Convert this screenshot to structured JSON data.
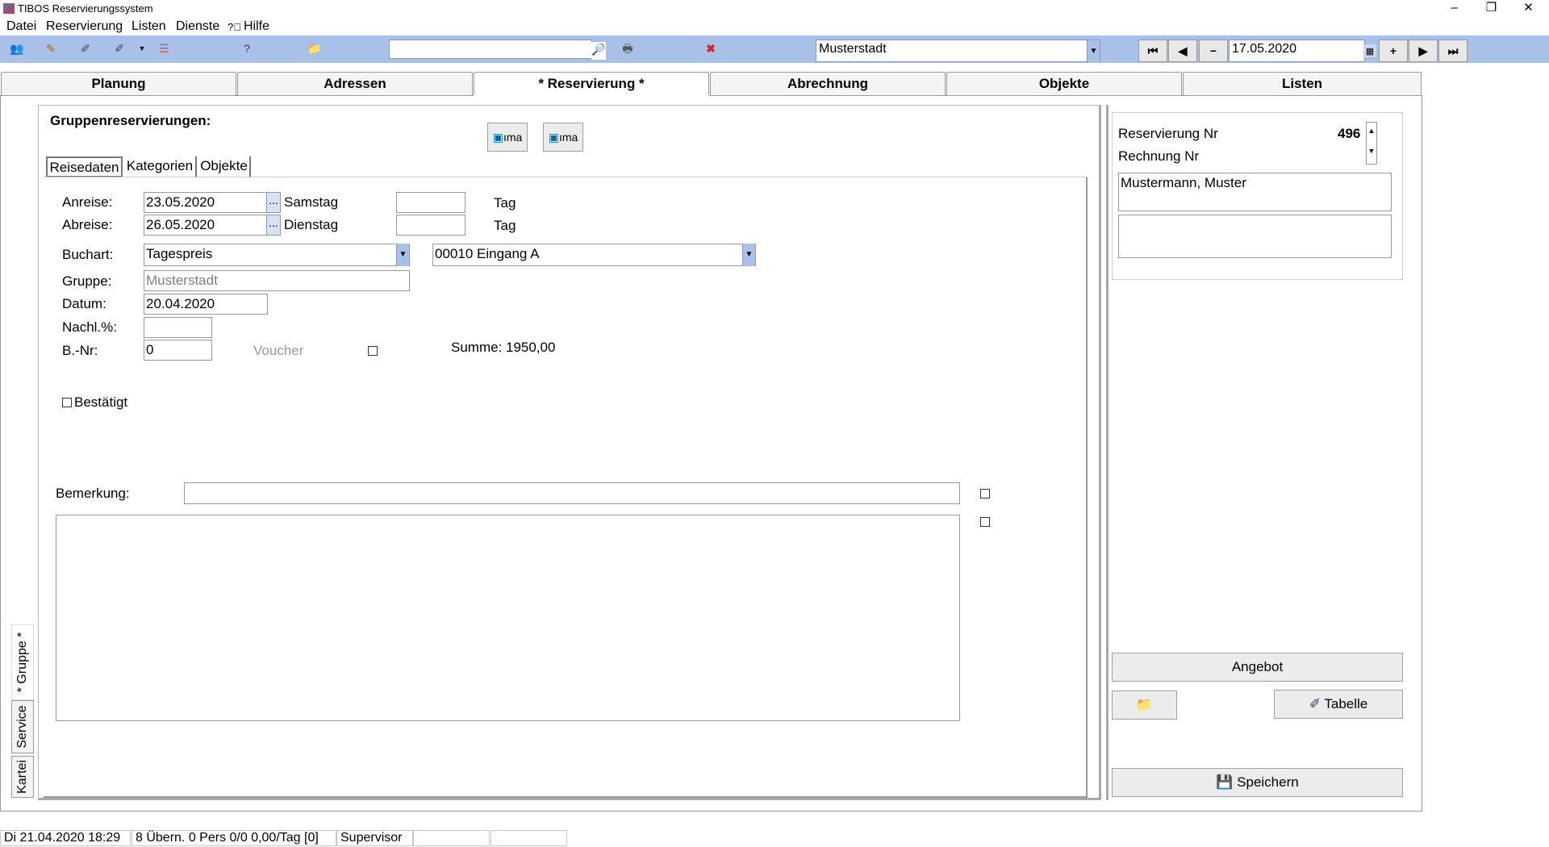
{
  "window": {
    "title": "TIBOS Reservierungssystem",
    "minimize": "–",
    "restore": "❐",
    "close": "✕"
  },
  "menu": [
    "Datei",
    "Reservierung",
    "Listen",
    "Dienste",
    "Hilfe"
  ],
  "toolbar": {
    "search_value": "",
    "location_value": "Musterstadt",
    "date_value": "17.05.2020",
    "nav": {
      "first": "⏮",
      "prev": "◀",
      "minus": "−",
      "plus": "+",
      "next": "▶",
      "last": "⏭"
    }
  },
  "tabs": [
    "Planung",
    "Adressen",
    "* Reservierung *",
    "Abrechnung",
    "Objekte",
    "Listen"
  ],
  "group": {
    "heading": "Gruppenreservierungen:",
    "icon_button_1": "ıma",
    "icon_button_2": "ıma"
  },
  "subtabs": [
    "Reisedaten",
    "Kategorien",
    "Objekte"
  ],
  "form": {
    "anreise_label": "Anreise:",
    "anreise_value": "23.05.2020",
    "anreise_day": "Samstag",
    "anreise_tag_value": "",
    "anreise_tag": "Tag",
    "abreise_label": "Abreise:",
    "abreise_value": "26.05.2020",
    "abreise_day": "Dienstag",
    "abreise_tag_value": "",
    "abreise_tag": "Tag",
    "dots": "...",
    "buchart_label": "Buchart:",
    "buchart_value": "Tagespreis",
    "eingang_value": "00010 Eingang A",
    "gruppe_label": "Gruppe:",
    "gruppe_value": "Musterstadt",
    "datum_label": "Datum:",
    "datum_value": "20.04.2020",
    "nachl_label": "Nachl.%:",
    "nachl_value": "",
    "bnr_label": "B.-Nr:",
    "bnr_value": "0",
    "voucher_label": "Voucher",
    "summe": "Summe: 1950,00",
    "bestaetigt_label": "Bestätigt",
    "bemerkung_label": "Bemerkung:",
    "bemerkung_value": "",
    "notes_value": ""
  },
  "right": {
    "res_nr_label": "Reservierung Nr",
    "res_nr_value": "496",
    "rechnung_label": "Rechnung Nr",
    "address": "Mustermann, Muster",
    "box2": "",
    "angebot": "Angebot",
    "tabelle": "Tabelle",
    "speichern": "Speichern"
  },
  "sidetabs": [
    "* Gruppe *",
    "Service",
    "Kartei"
  ],
  "status": {
    "datetime": "Di 21.04.2020 18:29",
    "info": "8 Übern. 0 Pers 0/0  0,00/Tag [0]",
    "user": "Supervisor",
    "cell4": "",
    "cell5": ""
  },
  "colors": {
    "toolbar": "#a9c1e8",
    "accent": "#8a9ab8"
  }
}
